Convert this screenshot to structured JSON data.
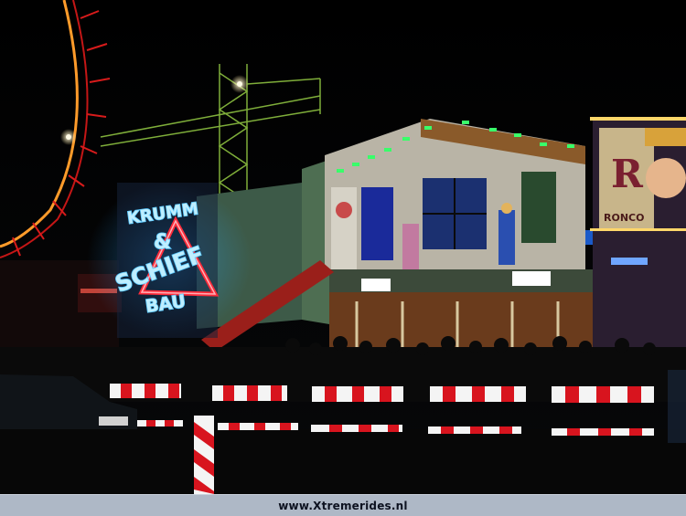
{
  "sign": {
    "line1": "KRUMM",
    "line2": "&",
    "line3": "SCHIEF",
    "line4": "BAU"
  },
  "rides_sign": {
    "letter": "R",
    "word": "RONCO"
  },
  "colors": {
    "neon_blue": "#4fc3ff",
    "neon_red": "#ff2b3a",
    "neon_green": "#39ff6a",
    "barrier_red": "#d8141e",
    "barrier_white": "#f4f4f4"
  },
  "footer": {
    "watermark": "www.Xtremerides.nl"
  }
}
